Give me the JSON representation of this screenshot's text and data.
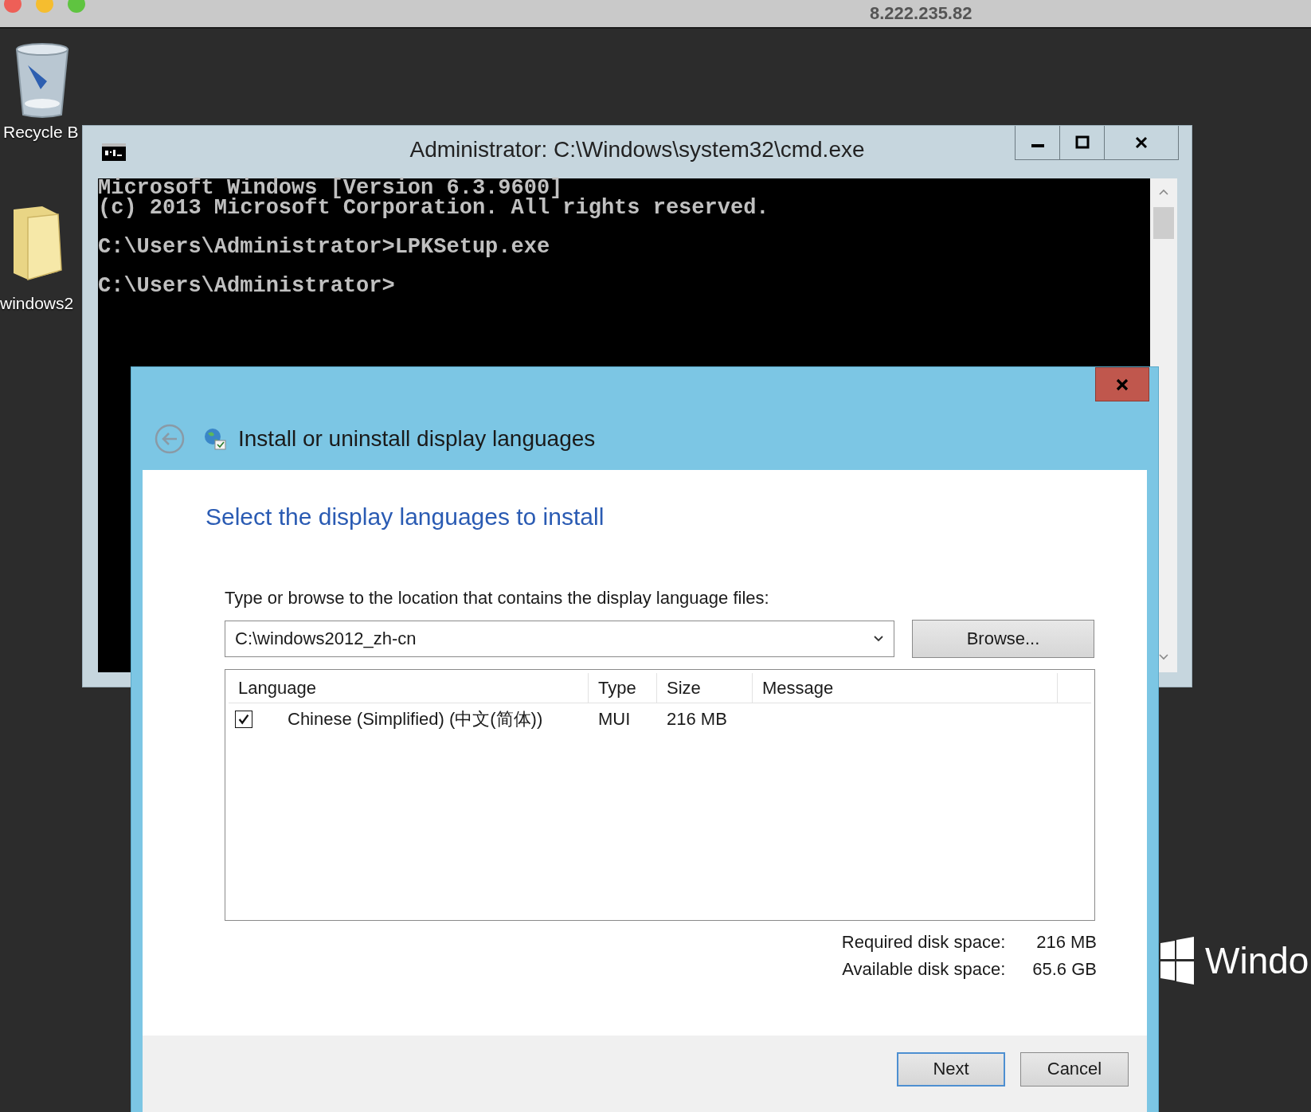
{
  "top_bar": {
    "title": "8.222.235.82"
  },
  "desktop_icons": [
    {
      "label": "Recycle B",
      "kind": "recycle-bin"
    },
    {
      "label": "windows2",
      "kind": "folder"
    }
  ],
  "cmd_window": {
    "title": "Administrator: C:\\Windows\\system32\\cmd.exe",
    "output_blocks": [
      [
        "Microsoft Windows [Version 6.3.9600]",
        "(c) 2013 Microsoft Corporation. All rights reserved."
      ],
      [
        "C:\\Users\\Administrator>LPKSetup.exe"
      ],
      [
        "C:\\Users\\Administrator>"
      ]
    ]
  },
  "dialog": {
    "title": "Install or uninstall display languages",
    "heading": "Select the display languages to install",
    "location_label": "Type or browse to the location that contains the display language files:",
    "location_value": "C:\\windows2012_zh-cn",
    "browse_button": "Browse...",
    "table": {
      "columns": [
        "Language",
        "Type",
        "Size",
        "Message"
      ],
      "rows": [
        {
          "checked": true,
          "language": "Chinese (Simplified) (中文(简体))",
          "type": "MUI",
          "size": "216 MB",
          "message": ""
        }
      ]
    },
    "disk_space": [
      {
        "label": "Required disk space:",
        "value": "216 MB"
      },
      {
        "label": "Available disk space:",
        "value": "65.6 GB"
      }
    ],
    "buttons": [
      {
        "label": "Next",
        "kind": "default"
      },
      {
        "label": "Cancel",
        "kind": "normal"
      }
    ]
  },
  "desktop_brand": {
    "text": "Windo"
  }
}
